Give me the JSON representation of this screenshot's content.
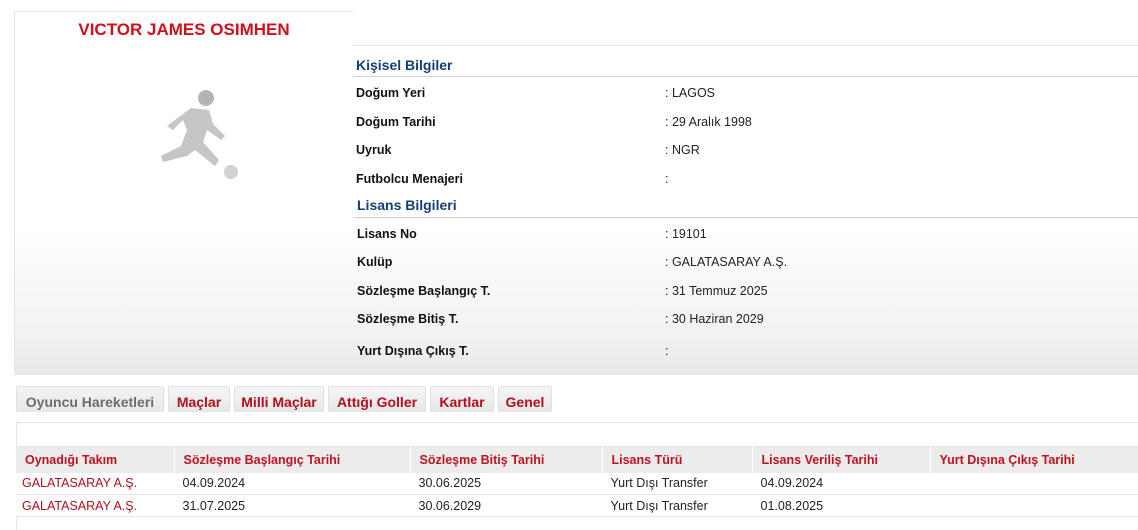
{
  "player": {
    "name": "VICTOR JAMES OSIMHEN"
  },
  "personal": {
    "title": "Kişisel Bilgiler",
    "rows": [
      {
        "label": "Doğum Yeri",
        "value": ":  LAGOS"
      },
      {
        "label": "Doğum Tarihi",
        "value": ":  29 Aralık 1998"
      },
      {
        "label": "Uyruk",
        "value": ":  NGR"
      },
      {
        "label": "Futbolcu Menajeri",
        "value": ":"
      }
    ]
  },
  "license": {
    "title": "Lisans Bilgileri",
    "rows": [
      {
        "label": "Lisans No",
        "value": ": 19101"
      },
      {
        "label": "Kulüp",
        "value": ": GALATASARAY A.Ş."
      },
      {
        "label": "Sözleşme Başlangıç T.",
        "value": ": 31 Temmuz 2025"
      },
      {
        "label": "Sözleşme Bitiş T.",
        "value": ": 30 Haziran 2029"
      },
      {
        "label": "Yurt Dışına Çıkış T.",
        "value": ":"
      }
    ]
  },
  "tabs": [
    {
      "label": "Oyuncu Hareketleri",
      "active": true
    },
    {
      "label": "Maçlar",
      "active": false
    },
    {
      "label": "Milli Maçlar",
      "active": false
    },
    {
      "label": "Attığı Goller",
      "active": false
    },
    {
      "label": "Kartlar",
      "active": false
    },
    {
      "label": "Genel",
      "active": false
    }
  ],
  "transfers": {
    "columns": [
      "Oynadığı Takım",
      "Sözleşme Başlangıç Tarihi",
      "Sözleşme Bitiş Tarihi",
      "Lisans Türü",
      "Lisans Veriliş Tarihi",
      "Yurt Dışına Çıkış Tarihi"
    ],
    "rows": [
      [
        "GALATASARAY A.Ş.",
        "04.09.2024",
        "30.06.2025",
        "Yurt Dışı Transfer",
        "04.09.2024",
        ""
      ],
      [
        "GALATASARAY A.Ş.",
        "31.07.2025",
        "30.06.2029",
        "Yurt Dışı Transfer",
        "01.08.2025",
        ""
      ]
    ]
  },
  "colors": {
    "name_red": "#d0101b",
    "section_blue": "#153e78",
    "tab_red": "#b0101b"
  }
}
